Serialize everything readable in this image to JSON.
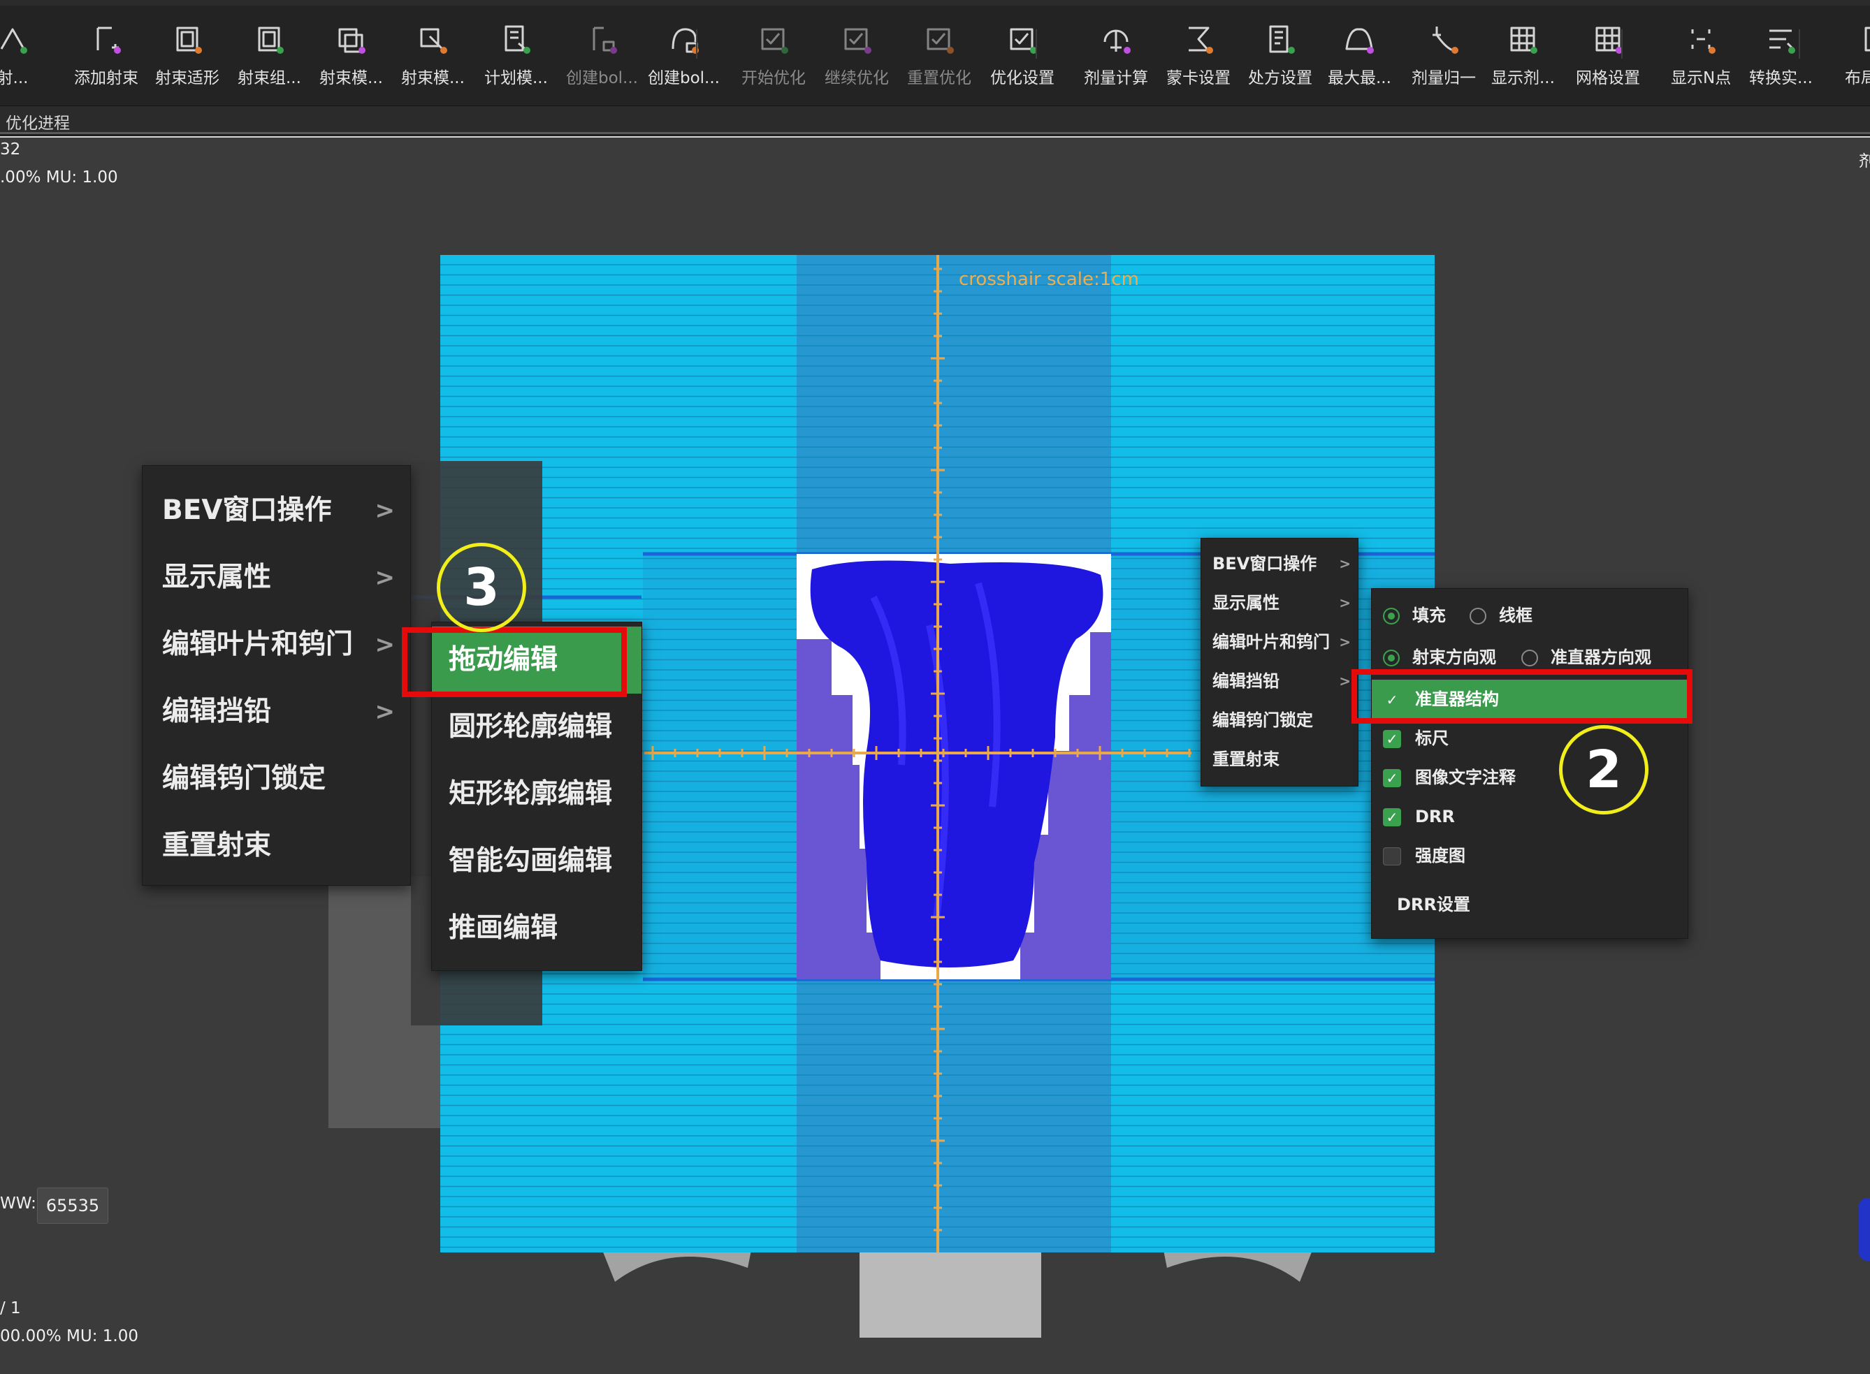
{
  "toolbar": {
    "items": [
      {
        "label": "射...",
        "icon": "beam-icon",
        "dim": false
      },
      {
        "label": "添加射束",
        "icon": "add-beam-icon",
        "dim": false
      },
      {
        "label": "射束适形",
        "icon": "beam-conform-icon",
        "dim": false
      },
      {
        "label": "射束组...",
        "icon": "beam-group-icon",
        "dim": false
      },
      {
        "label": "射束模...",
        "icon": "beam-template-icon",
        "dim": false
      },
      {
        "label": "射束模...",
        "icon": "beam-template-edit-icon",
        "dim": false
      },
      {
        "label": "计划模...",
        "icon": "plan-template-icon",
        "dim": false
      },
      {
        "label": "创建bol...",
        "icon": "create-bolus-icon",
        "dim": true
      },
      {
        "label": "创建bol...",
        "icon": "create-bolus-shape-icon",
        "dim": false
      },
      {
        "label": "开始优化",
        "icon": "start-optimize-icon",
        "dim": true
      },
      {
        "label": "继续优化",
        "icon": "continue-optimize-icon",
        "dim": true
      },
      {
        "label": "重置优化",
        "icon": "reset-optimize-icon",
        "dim": true
      },
      {
        "label": "优化设置",
        "icon": "optimize-settings-icon",
        "dim": false
      },
      {
        "label": "剂量计算",
        "icon": "dose-calc-icon",
        "dim": false
      },
      {
        "label": "蒙卡设置",
        "icon": "monte-carlo-settings-icon",
        "dim": false
      },
      {
        "label": "处方设置",
        "icon": "prescription-settings-icon",
        "dim": false
      },
      {
        "label": "最大最...",
        "icon": "max-min-icon",
        "dim": false
      },
      {
        "label": "剂量归一",
        "icon": "dose-normalize-icon",
        "dim": false
      },
      {
        "label": "显示剂...",
        "icon": "show-dose-icon",
        "dim": false
      },
      {
        "label": "网格设置",
        "icon": "grid-settings-icon",
        "dim": false
      },
      {
        "label": "显示N点",
        "icon": "show-n-point-icon",
        "dim": false
      },
      {
        "label": "转换实...",
        "icon": "convert-icon",
        "dim": false
      },
      {
        "label": "布局管理",
        "icon": "layout-icon",
        "dim": false
      }
    ]
  },
  "tabbar": {
    "active_tab": "优化进程"
  },
  "viewport": {
    "top_left_line1": "32",
    "top_left_line2": ".00% MU: 1.00",
    "top_right": "剂",
    "crosshair_label": "crosshair scale:1cm",
    "ww_label": "WW:",
    "ww_value": "65535",
    "bottom_left_line1": "/ 1",
    "bottom_left_line2": "00.00% MU: 1.00"
  },
  "menu_large": {
    "items": [
      {
        "label": "BEV窗口操作",
        "has_sub": true
      },
      {
        "label": "显示属性",
        "has_sub": true
      },
      {
        "label": "编辑叶片和钨门",
        "has_sub": true
      },
      {
        "label": "编辑挡铅",
        "has_sub": true
      },
      {
        "label": "编辑钨门锁定",
        "has_sub": false
      },
      {
        "label": "重置射束",
        "has_sub": false
      }
    ]
  },
  "submenu_edit": {
    "items": [
      {
        "label": "拖动编辑",
        "highlight": true
      },
      {
        "label": "圆形轮廓编辑",
        "highlight": false
      },
      {
        "label": "矩形轮廓编辑",
        "highlight": false
      },
      {
        "label": "智能勾画编辑",
        "highlight": false
      },
      {
        "label": "推画编辑",
        "highlight": false
      }
    ]
  },
  "menu_small": {
    "items": [
      {
        "label": "BEV窗口操作",
        "has_sub": true
      },
      {
        "label": "显示属性",
        "has_sub": true
      },
      {
        "label": "编辑叶片和钨门",
        "has_sub": true
      },
      {
        "label": "编辑挡铅",
        "has_sub": true
      },
      {
        "label": "编辑钨门锁定",
        "has_sub": false
      },
      {
        "label": "重置射束",
        "has_sub": false
      }
    ]
  },
  "submenu_display": {
    "fill": "填充",
    "wireframe": "线框",
    "beam_view": "射束方向观",
    "collimator_view": "准直器方向观",
    "collimator_structure": "准直器结构",
    "ruler": "标尺",
    "image_annotation": "图像文字注释",
    "drr": "DRR",
    "intensity_map": "强度图",
    "drr_settings": "DRR设置"
  },
  "callouts": {
    "step2": "2",
    "step3": "3"
  },
  "colors": {
    "field_cyan": "#12bde8",
    "field_mid": "#2697d1",
    "target_blue": "#1f16e0",
    "crosshair": "#e9a84a",
    "highlight_green": "#3b9b4c",
    "annotation_red": "#e50b0b",
    "callout_yellow": "#f1ee1a"
  }
}
